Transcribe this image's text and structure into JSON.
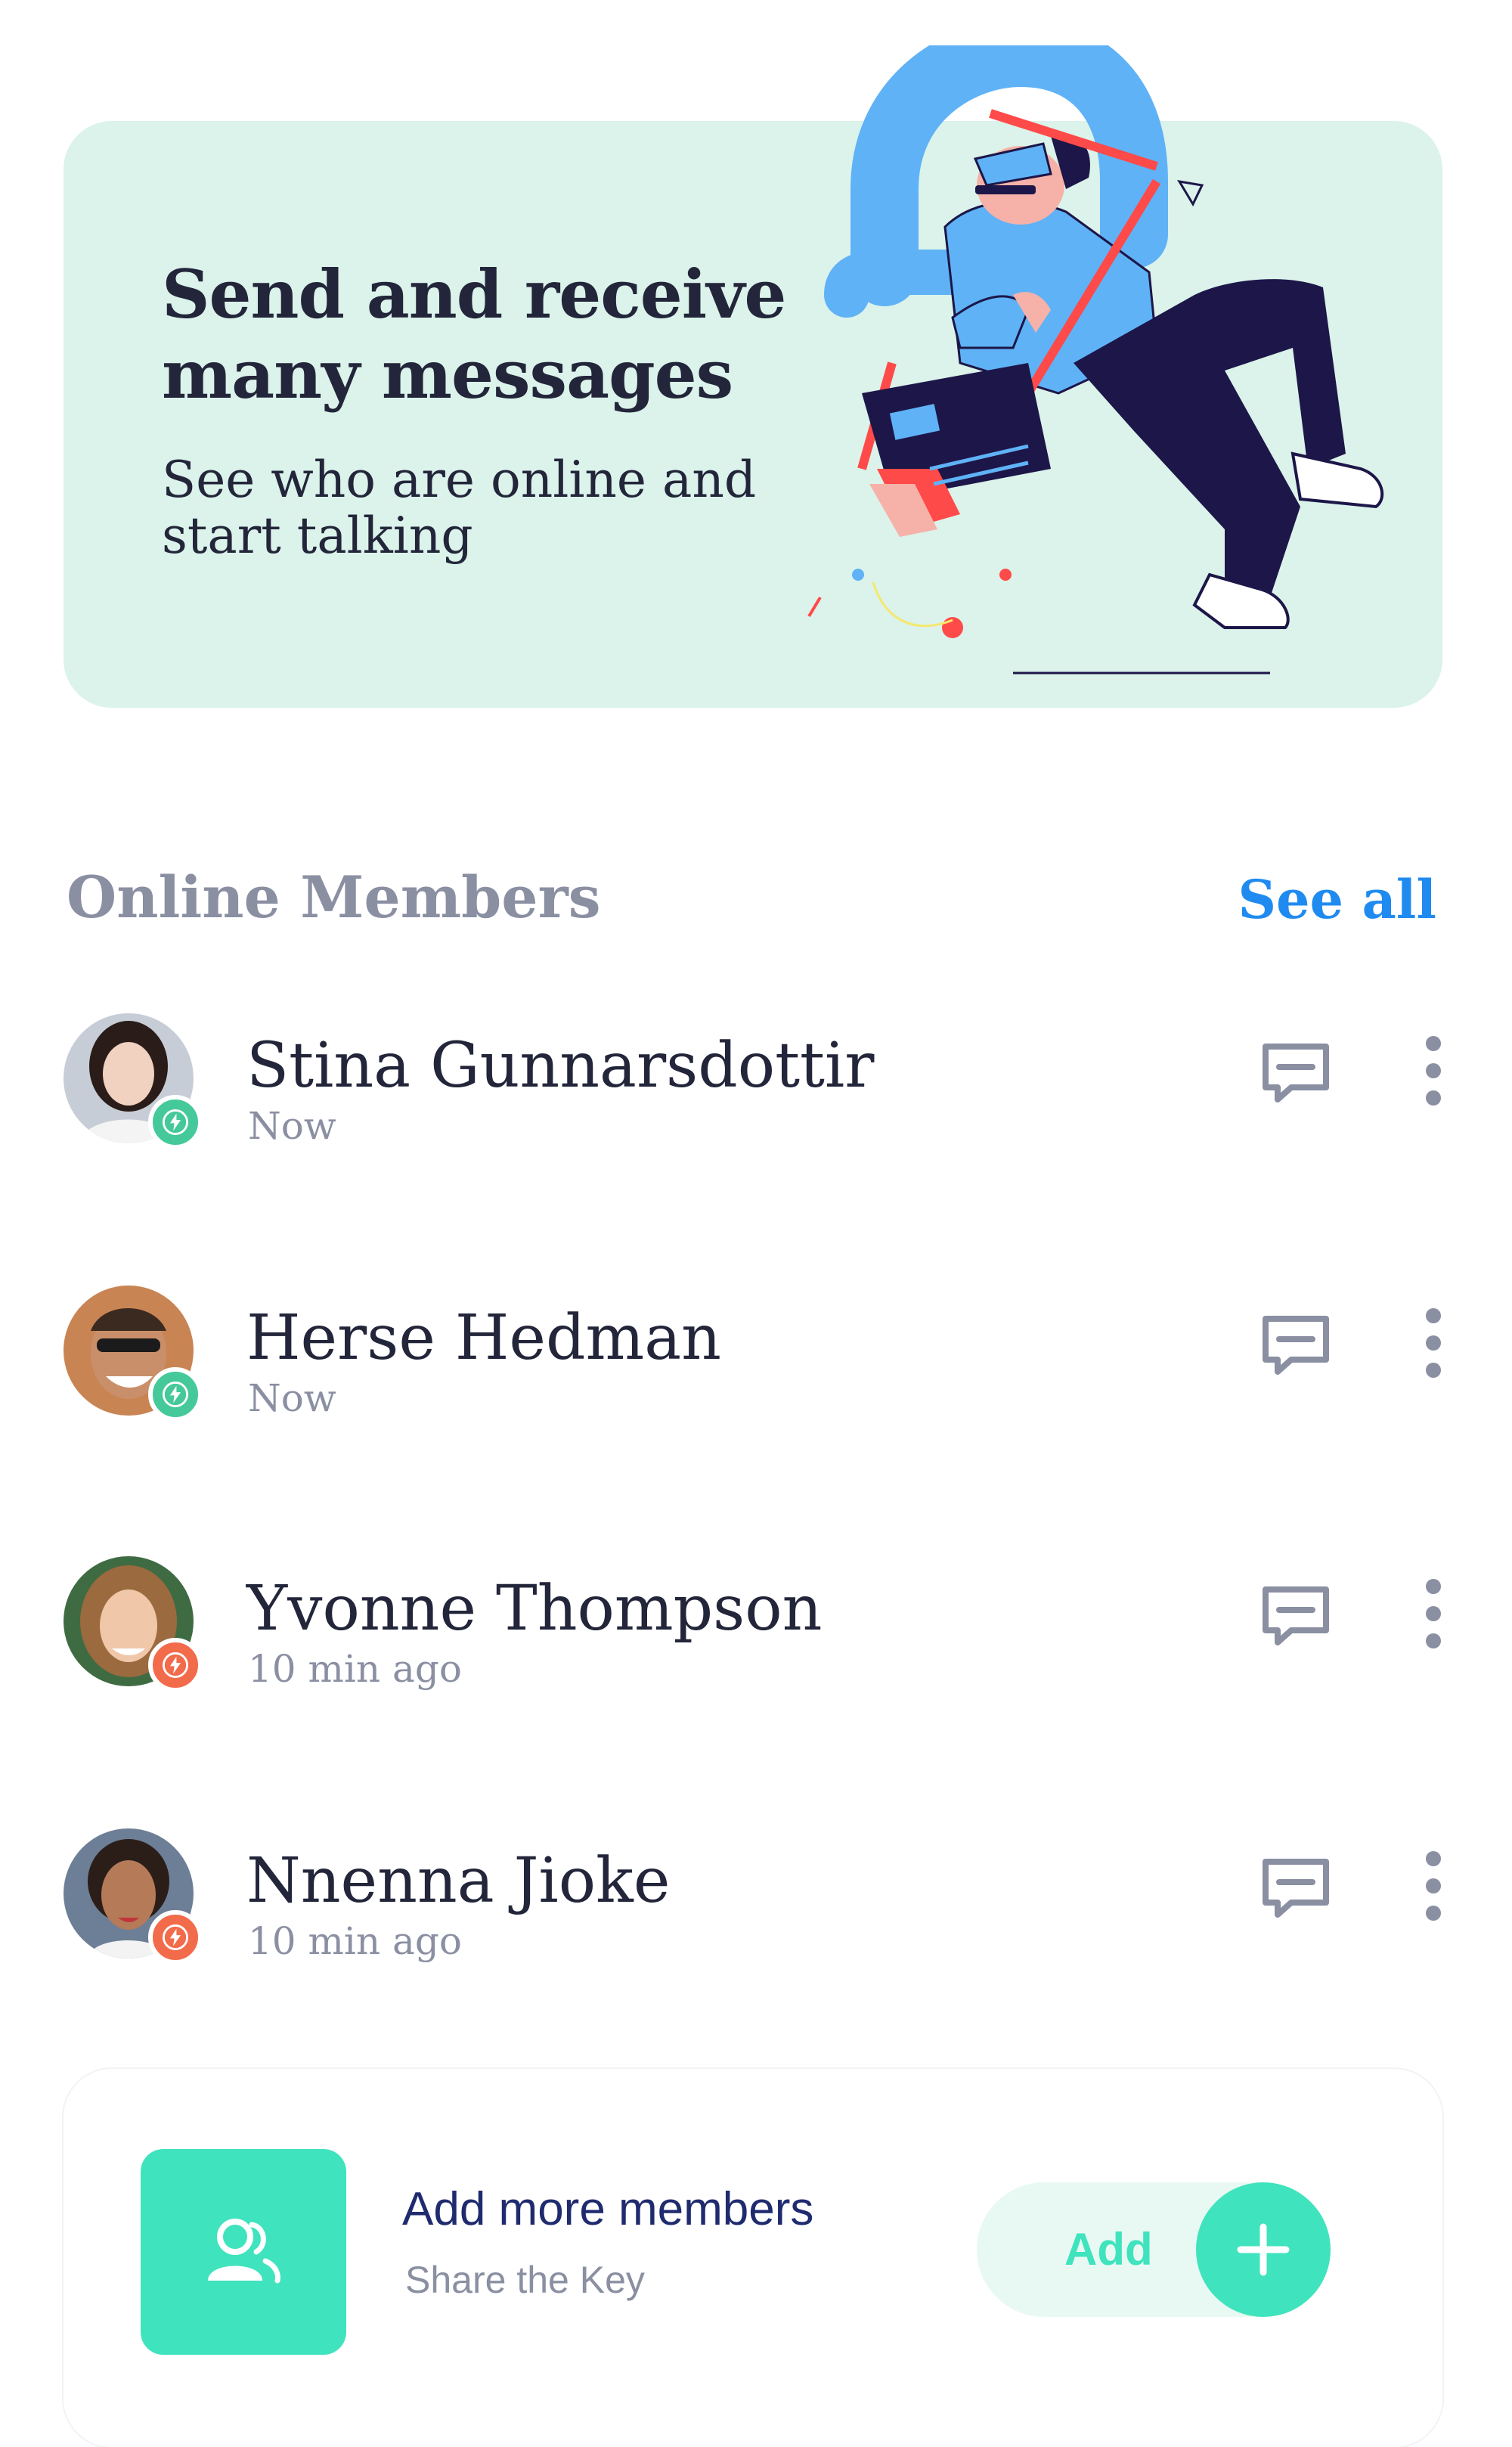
{
  "hero": {
    "title": "Send and receive many messages",
    "subtitle": "See who are online and start talking"
  },
  "online_section": {
    "title": "Online Members",
    "see_all": "See all"
  },
  "members": [
    {
      "name": "Stina Gunnarsdottir",
      "time": "Now",
      "status": "green",
      "status_color": "#45c99a"
    },
    {
      "name": "Herse Hedman",
      "time": "Now",
      "status": "green",
      "status_color": "#45c99a"
    },
    {
      "name": "Yvonne Thompson",
      "time": "10 min ago",
      "status": "orange",
      "status_color": "#f26b4b"
    },
    {
      "name": "Nnenna Jioke",
      "time": "10 min ago",
      "status": "orange",
      "status_color": "#f26b4b"
    }
  ],
  "add_members": {
    "title": "Add more members",
    "subtitle": "Share the Key",
    "button_label": "Add"
  },
  "colors": {
    "accent": "#3fe3bd",
    "link": "#1f8bf0",
    "hero_bg": "#dbf3ea",
    "online": "#45c99a",
    "away": "#f26b4b"
  },
  "icons": [
    "mail-carrier-illustration",
    "lightning-icon",
    "message-icon",
    "more-vertical-icon",
    "user-group-icon",
    "plus-icon"
  ]
}
